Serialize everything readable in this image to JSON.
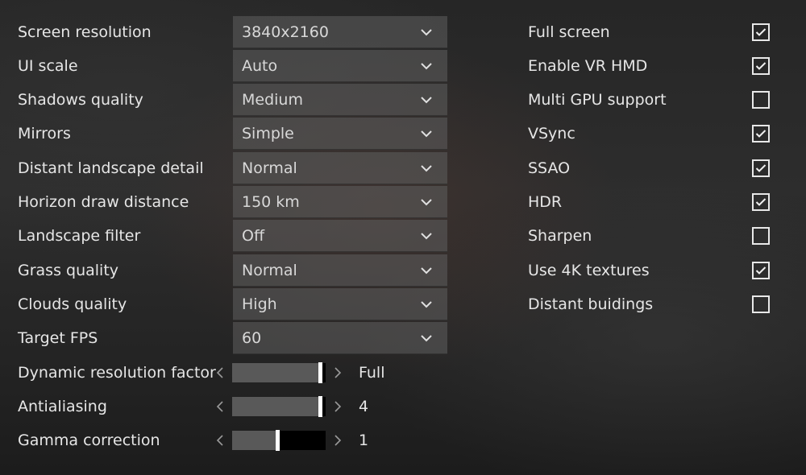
{
  "dropdowns": [
    {
      "label": "Screen resolution",
      "value": "3840x2160"
    },
    {
      "label": "UI scale",
      "value": "Auto"
    },
    {
      "label": "Shadows quality",
      "value": "Medium"
    },
    {
      "label": "Mirrors",
      "value": "Simple"
    },
    {
      "label": "Distant landscape detail",
      "value": "Normal"
    },
    {
      "label": "Horizon draw distance",
      "value": "150 km"
    },
    {
      "label": "Landscape filter",
      "value": "Off"
    },
    {
      "label": "Grass quality",
      "value": "Normal"
    },
    {
      "label": "Clouds quality",
      "value": "High"
    },
    {
      "label": "Target FPS",
      "value": "60"
    }
  ],
  "sliders": [
    {
      "label": "Dynamic resolution factor",
      "value": "Full",
      "level": 1.0
    },
    {
      "label": "Antialiasing",
      "value": "4",
      "level": 1.0
    },
    {
      "label": "Gamma correction",
      "value": "1",
      "level": 0.5
    }
  ],
  "checkboxes": [
    {
      "label": "Full screen",
      "checked": true
    },
    {
      "label": "Enable VR HMD",
      "checked": true
    },
    {
      "label": "Multi GPU support",
      "checked": false
    },
    {
      "label": "VSync",
      "checked": true
    },
    {
      "label": "SSAO",
      "checked": true
    },
    {
      "label": "HDR",
      "checked": true
    },
    {
      "label": "Sharpen",
      "checked": false
    },
    {
      "label": "Use 4K textures",
      "checked": true
    },
    {
      "label": "Distant buidings",
      "checked": false
    }
  ],
  "icons": {
    "dropdown": "chevron-down-icon",
    "slider_left": "chevron-left-icon",
    "slider_right": "chevron-right-icon",
    "checkbox": "checkmark-icon"
  },
  "colors": {
    "text": "#e6e6e6",
    "dropdown_bg": "#5f5f5f",
    "slider_fill": "#595959",
    "slider_track": "#000000",
    "thumb": "#ffffff"
  }
}
